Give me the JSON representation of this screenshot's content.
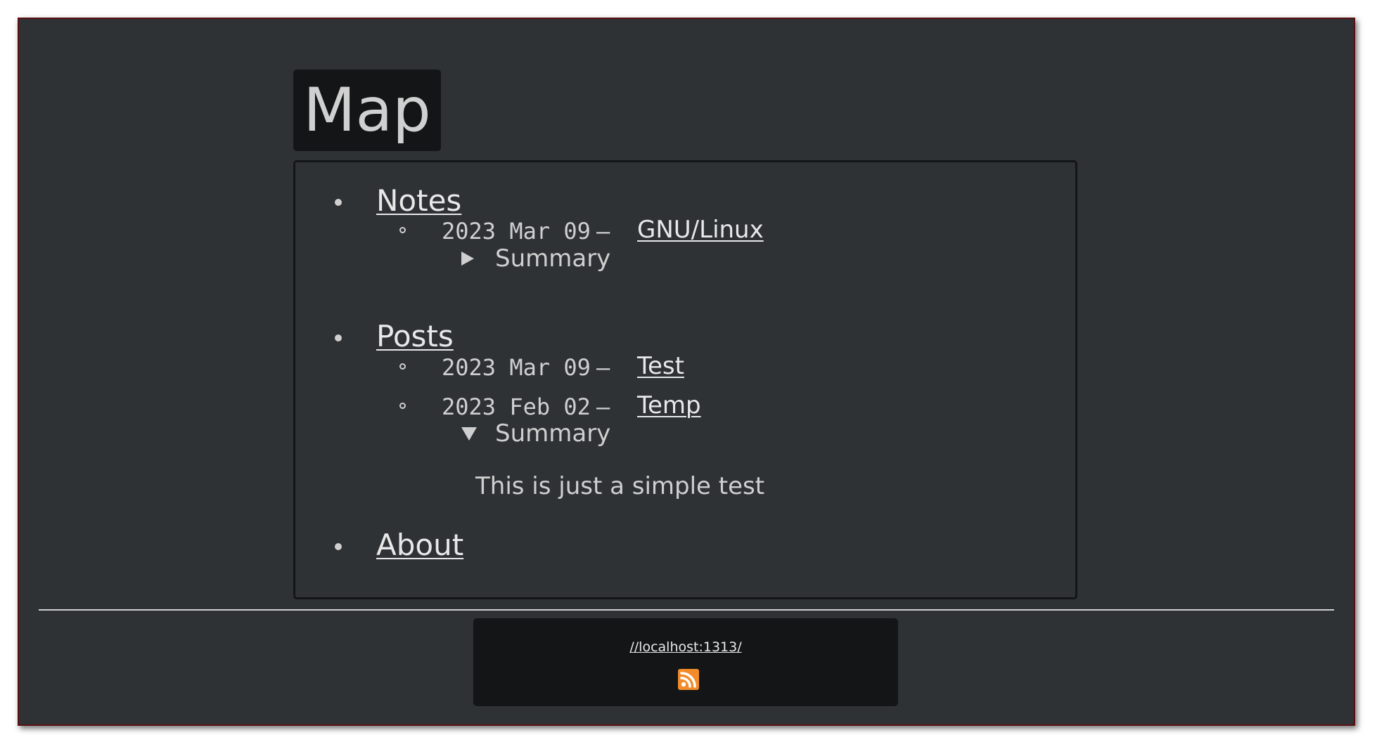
{
  "page": {
    "title": "Map"
  },
  "sections": [
    {
      "label": "Notes",
      "entries": [
        {
          "date": "2023 Mar 09",
          "dash": "—",
          "link": "GNU/Linux",
          "summary": {
            "label": "Summary",
            "open": false,
            "text": ""
          }
        }
      ]
    },
    {
      "label": "Posts",
      "entries": [
        {
          "date": "2023 Mar 09",
          "dash": "—",
          "link": "Test",
          "summary": null
        },
        {
          "date": "2023 Feb 02",
          "dash": "—",
          "link": "Temp",
          "summary": {
            "label": "Summary",
            "open": true,
            "text": "This is just a simple test"
          }
        }
      ]
    },
    {
      "label": "About",
      "entries": []
    }
  ],
  "footer": {
    "link": "//localhost:1313/",
    "icon": "rss-icon"
  },
  "colors": {
    "background": "#2e3235",
    "panel_dark": "#131516",
    "text": "#cfcfcf",
    "rss_orange": "#f28b2a",
    "frame_border": "#5a0f10"
  }
}
